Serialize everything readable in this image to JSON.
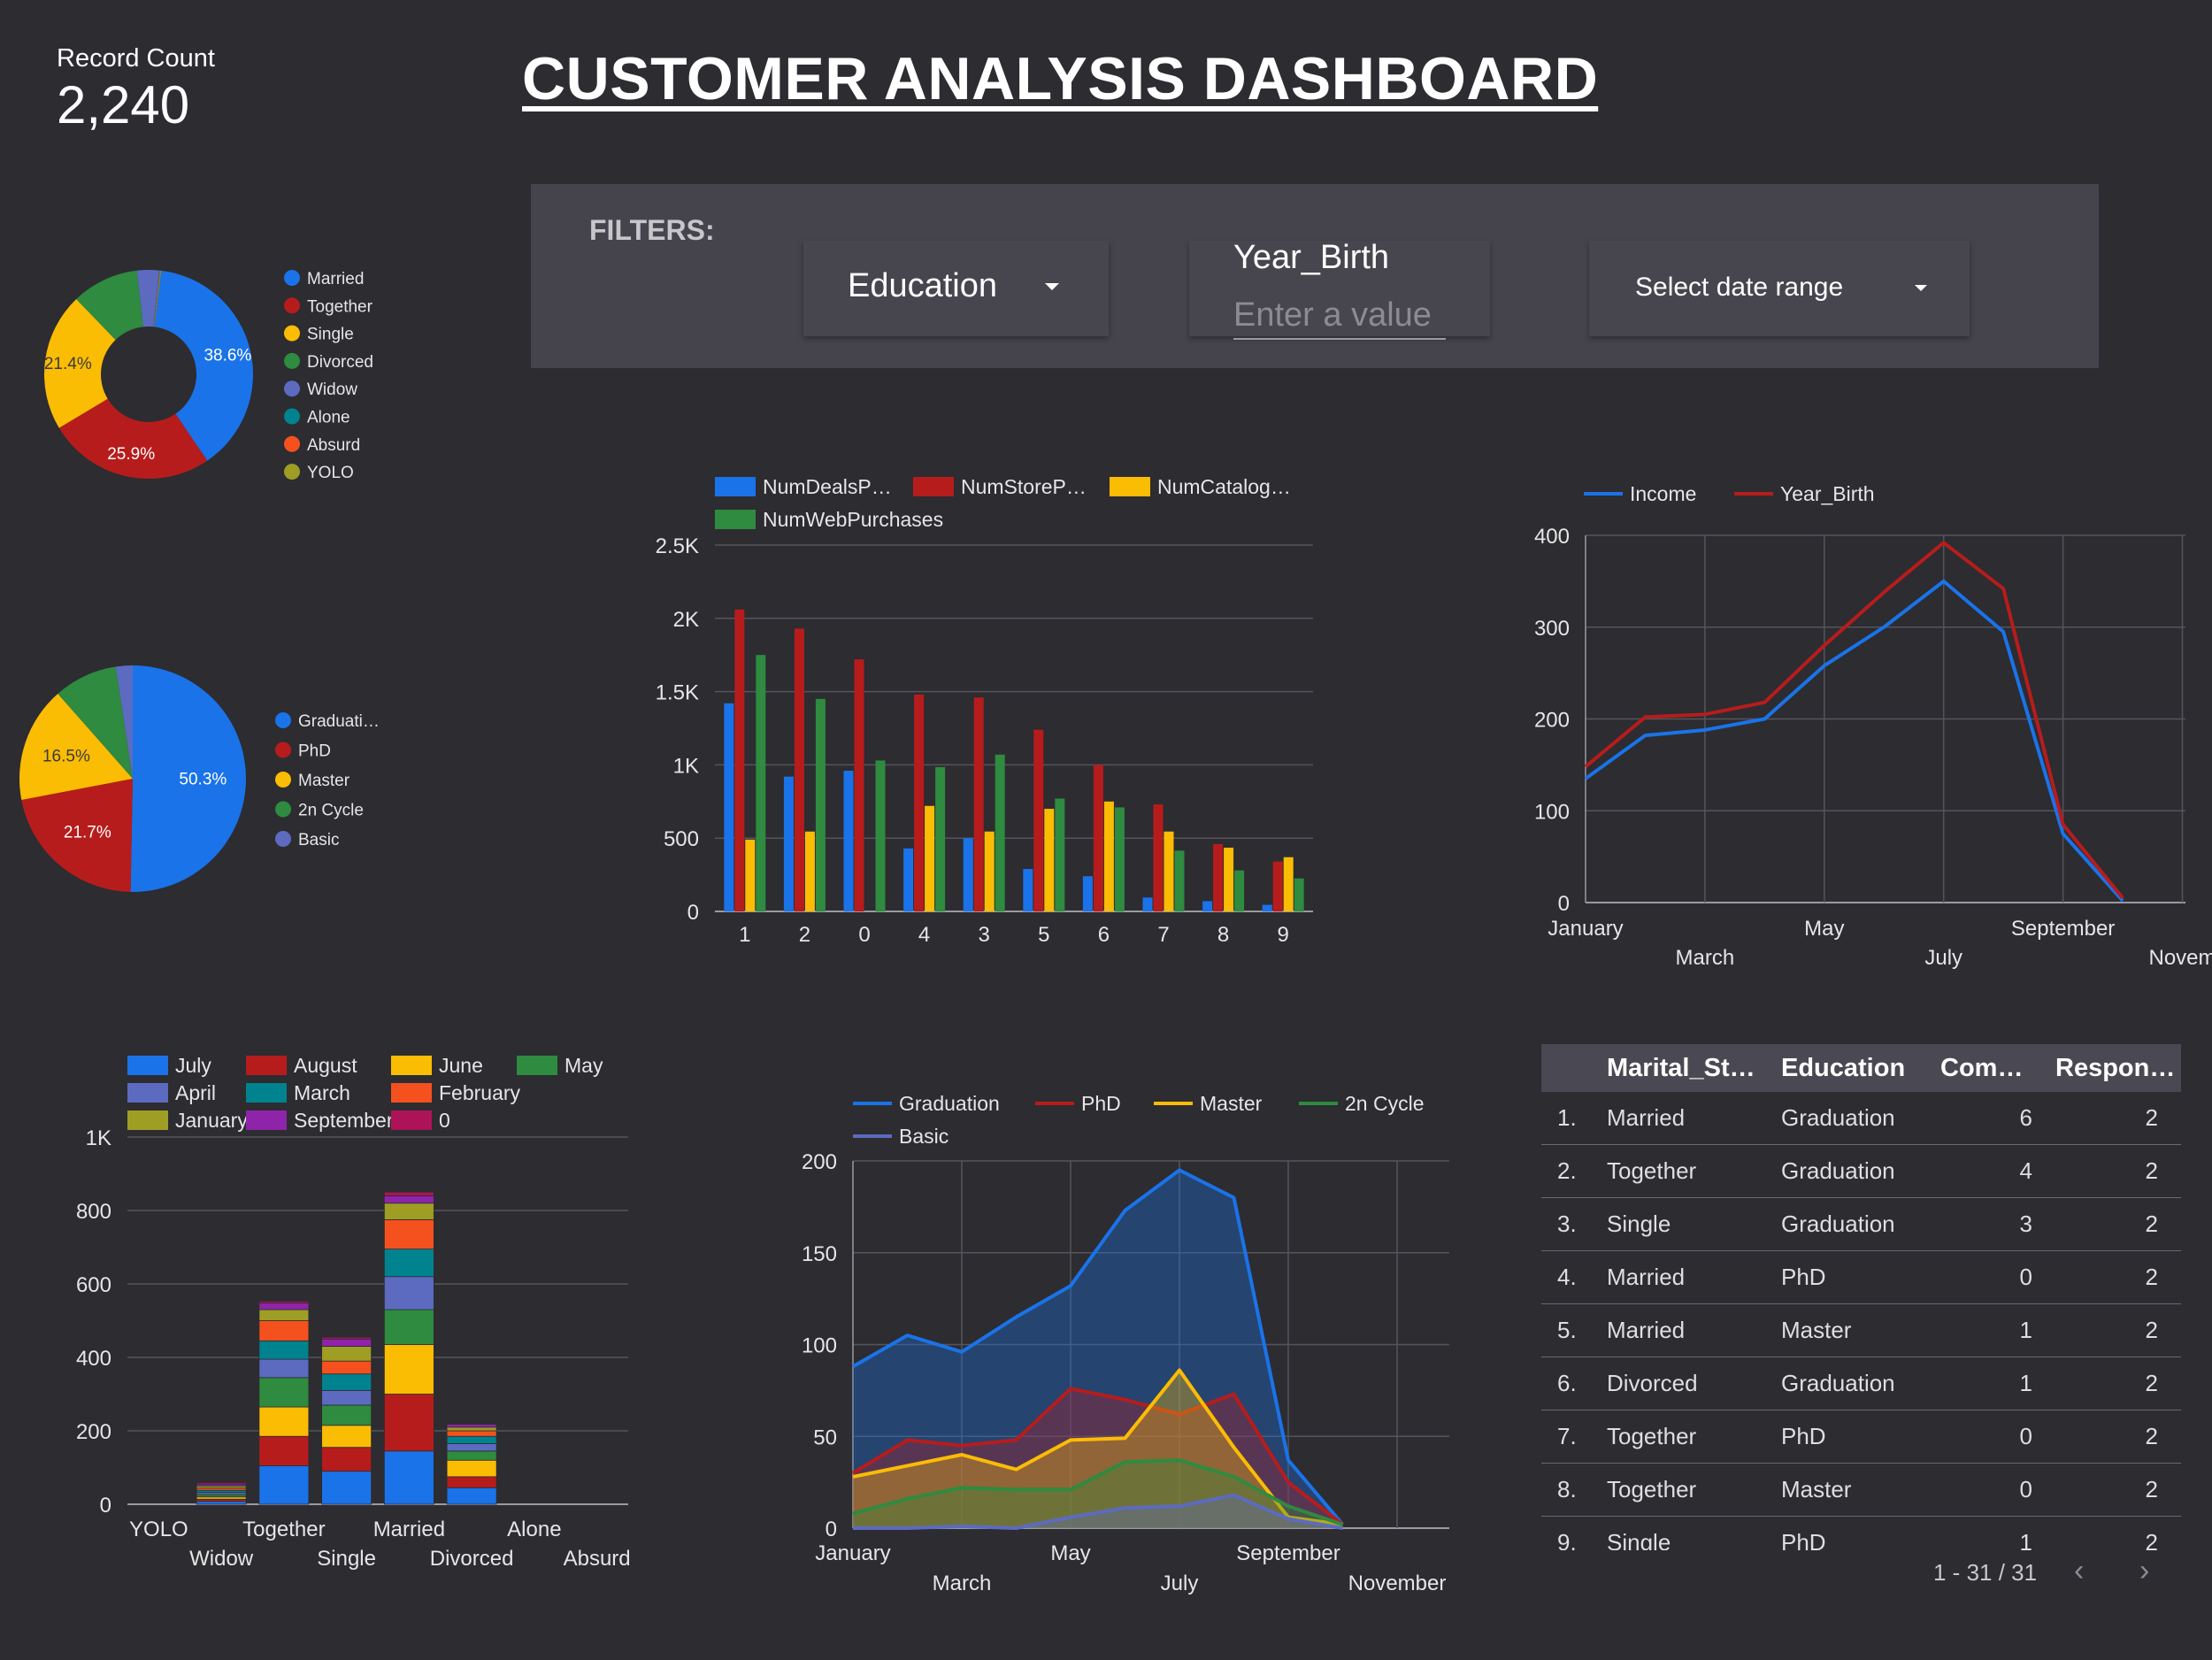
{
  "scorecard": {
    "label": "Record Count",
    "value": "2,240"
  },
  "title": "CUSTOMER ANALYSIS  DASHBOARD",
  "filters": {
    "label": "FILTERS:",
    "education": "Education",
    "year_birth": {
      "label": "Year_Birth",
      "placeholder": "Enter a value"
    },
    "date_range": "Select date range"
  },
  "colors": {
    "blue": "#1a73e8",
    "red": "#b71c1c",
    "yellow": "#fbbc04",
    "green": "#2e8b3f",
    "purple": "#5c6bc0",
    "teal": "#00838f",
    "orange": "#f4511e",
    "olive": "#9e9d24",
    "magenta": "#8e24aa",
    "crimson": "#ad1457"
  },
  "table": {
    "headers": [
      "Marital_St…",
      "Education",
      "Com…",
      "Respon…"
    ],
    "rows": [
      [
        "1.",
        "Married",
        "Graduation",
        "6",
        "2"
      ],
      [
        "2.",
        "Together",
        "Graduation",
        "4",
        "2"
      ],
      [
        "3.",
        "Single",
        "Graduation",
        "3",
        "2"
      ],
      [
        "4.",
        "Married",
        "PhD",
        "0",
        "2"
      ],
      [
        "5.",
        "Married",
        "Master",
        "1",
        "2"
      ],
      [
        "6.",
        "Divorced",
        "Graduation",
        "1",
        "2"
      ],
      [
        "7.",
        "Together",
        "PhD",
        "0",
        "2"
      ],
      [
        "8.",
        "Together",
        "Master",
        "0",
        "2"
      ],
      [
        "9.",
        "Single",
        "PhD",
        "1",
        "2"
      ]
    ],
    "pagination": "1 - 31 / 31",
    "prev_icon": "chevron-left-icon",
    "next_icon": "chevron-right-icon"
  },
  "chart_data": [
    {
      "type": "pie",
      "subtype": "donut",
      "legend": [
        "Married",
        "Together",
        "Single",
        "Divorced",
        "Widow",
        "Alone",
        "Absurd",
        "YOLO"
      ],
      "values": [
        38.6,
        25.9,
        21.4,
        10.4,
        3.4,
        0.1,
        0.1,
        0.1
      ],
      "labels": [
        "38.6%",
        "25.9%",
        "21.4%",
        "",
        "",
        "",
        "",
        ""
      ],
      "colors": [
        "#1a73e8",
        "#b71c1c",
        "#fbbc04",
        "#2e8b3f",
        "#5c6bc0",
        "#00838f",
        "#f4511e",
        "#9e9d24"
      ],
      "legend_position": "right"
    },
    {
      "type": "pie",
      "legend": [
        "Graduati…",
        "PhD",
        "Master",
        "2n Cycle",
        "Basic"
      ],
      "values": [
        50.3,
        21.7,
        16.5,
        9.1,
        2.4
      ],
      "labels": [
        "50.3%",
        "21.7%",
        "16.5%",
        "",
        ""
      ],
      "colors": [
        "#1a73e8",
        "#b71c1c",
        "#fbbc04",
        "#2e8b3f",
        "#5c6bc0"
      ],
      "legend_position": "right"
    },
    {
      "type": "bar",
      "categories": [
        "1",
        "2",
        "0",
        "4",
        "3",
        "5",
        "6",
        "7",
        "8",
        "9"
      ],
      "series": [
        {
          "name": "NumDealsP…",
          "values": [
            1420,
            920,
            960,
            430,
            500,
            290,
            240,
            95,
            70,
            45
          ],
          "color": "#1a73e8"
        },
        {
          "name": "NumStoreP…",
          "values": [
            2060,
            1930,
            1720,
            1480,
            1460,
            1240,
            1000,
            730,
            460,
            340
          ],
          "color": "#b71c1c"
        },
        {
          "name": "NumCatalog…",
          "values": [
            490,
            545,
            0,
            720,
            545,
            700,
            750,
            545,
            435,
            370
          ],
          "color": "#fbbc04"
        },
        {
          "name": "NumWebPurchases",
          "values": [
            1750,
            1450,
            1030,
            985,
            1070,
            770,
            710,
            415,
            280,
            225
          ],
          "color": "#2e8b3f"
        }
      ],
      "yticks": [
        "0",
        "500",
        "1K",
        "1.5K",
        "2K",
        "2.5K"
      ],
      "ylim": [
        0,
        2500
      ],
      "legend_position": "top",
      "grid": true
    },
    {
      "type": "line",
      "x": [
        "January",
        "February",
        "March",
        "April",
        "May",
        "June",
        "July",
        "August",
        "September",
        "October",
        "November"
      ],
      "xticks_shown": [
        "January",
        "March",
        "May",
        "July",
        "September",
        "Novem"
      ],
      "series": [
        {
          "name": "Income",
          "values": [
            135,
            182,
            188,
            200,
            258,
            300,
            350,
            295,
            75,
            2,
            null
          ],
          "color": "#1a73e8"
        },
        {
          "name": "Year_Birth",
          "values": [
            148,
            202,
            205,
            218,
            280,
            338,
            392,
            342,
            85,
            5,
            null
          ],
          "color": "#b71c1c"
        }
      ],
      "yticks": [
        "0",
        "100",
        "200",
        "300",
        "400"
      ],
      "ylim": [
        0,
        400
      ],
      "legend_position": "top",
      "grid": true
    },
    {
      "type": "bar",
      "stacked": true,
      "categories": [
        "YOLO",
        "Widow",
        "Together",
        "Single",
        "Married",
        "Divorced",
        "Alone",
        "Absurd"
      ],
      "series": [
        {
          "name": "July",
          "values": [
            0,
            8,
            105,
            90,
            145,
            45,
            0,
            0
          ],
          "color": "#1a73e8"
        },
        {
          "name": "August",
          "values": [
            0,
            6,
            80,
            65,
            155,
            30,
            0,
            0
          ],
          "color": "#b71c1c"
        },
        {
          "name": "June",
          "values": [
            0,
            6,
            80,
            60,
            135,
            45,
            0,
            0
          ],
          "color": "#fbbc04"
        },
        {
          "name": "May",
          "values": [
            0,
            6,
            80,
            55,
            95,
            25,
            0,
            0
          ],
          "color": "#2e8b3f"
        },
        {
          "name": "April",
          "values": [
            0,
            6,
            50,
            40,
            90,
            20,
            0,
            0
          ],
          "color": "#5c6bc0"
        },
        {
          "name": "March",
          "values": [
            0,
            6,
            50,
            45,
            75,
            20,
            0,
            0
          ],
          "color": "#00838f"
        },
        {
          "name": "February",
          "values": [
            0,
            6,
            55,
            35,
            80,
            15,
            0,
            0
          ],
          "color": "#f4511e"
        },
        {
          "name": "January",
          "values": [
            0,
            6,
            30,
            40,
            45,
            10,
            0,
            0
          ],
          "color": "#9e9d24"
        },
        {
          "name": "September",
          "values": [
            0,
            5,
            18,
            20,
            20,
            8,
            0,
            0
          ],
          "color": "#8e24aa"
        },
        {
          "name": "0",
          "values": [
            0,
            4,
            5,
            5,
            10,
            2,
            0,
            0
          ],
          "color": "#ad1457"
        }
      ],
      "yticks": [
        "0",
        "200",
        "400",
        "600",
        "800",
        "1K"
      ],
      "ylim": [
        0,
        1000
      ],
      "legend_position": "top",
      "grid": true
    },
    {
      "type": "area",
      "x": [
        "January",
        "February",
        "March",
        "April",
        "May",
        "June",
        "July",
        "August",
        "September",
        "October",
        "November"
      ],
      "xticks_shown": [
        "January",
        "March",
        "May",
        "July",
        "September",
        "November"
      ],
      "series": [
        {
          "name": "Graduation",
          "values": [
            88,
            105,
            96,
            115,
            132,
            173,
            195,
            180,
            37,
            2,
            null
          ],
          "color": "#1a73e8"
        },
        {
          "name": "PhD",
          "values": [
            30,
            48,
            45,
            48,
            76,
            70,
            62,
            73,
            25,
            2,
            null
          ],
          "color": "#b71c1c"
        },
        {
          "name": "Master",
          "values": [
            28,
            34,
            40,
            32,
            48,
            49,
            86,
            44,
            6,
            2,
            null
          ],
          "color": "#fbbc04"
        },
        {
          "name": "2n Cycle",
          "values": [
            8,
            16,
            22,
            21,
            21,
            36,
            37,
            28,
            12,
            2,
            null
          ],
          "color": "#2e8b3f"
        },
        {
          "name": "Basic",
          "values": [
            0,
            0,
            1,
            0,
            6,
            11,
            12,
            18,
            5,
            0,
            null
          ],
          "color": "#5c6bc0"
        }
      ],
      "yticks": [
        "0",
        "50",
        "100",
        "150",
        "200"
      ],
      "ylim": [
        0,
        200
      ],
      "legend_position": "top",
      "grid": true
    }
  ]
}
